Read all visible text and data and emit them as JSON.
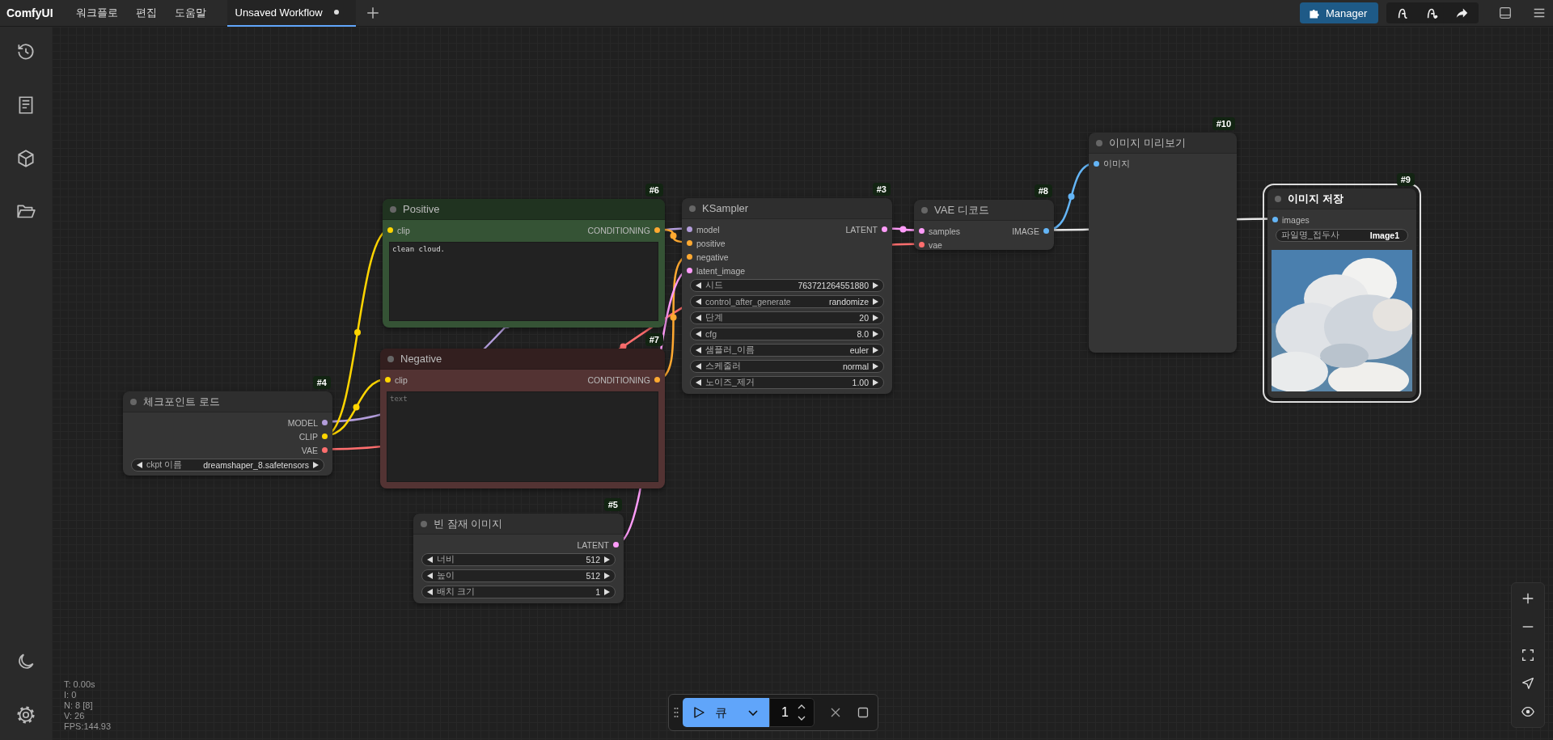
{
  "topbar": {
    "brand": "ComfyUI",
    "menu": [
      {
        "label": "워크플로"
      },
      {
        "label": "편집"
      },
      {
        "label": "도움말"
      }
    ],
    "tabs": [
      {
        "label": "Unsaved Workflow",
        "selected": true,
        "modified": true
      }
    ],
    "manager": "Manager"
  },
  "nodes": [
    {
      "badge": "#4",
      "title": "체크포인트 로드",
      "selected": false,
      "outputs": [
        {
          "name": "MODEL",
          "color": "#b39ddb"
        },
        {
          "name": "CLIP",
          "color": "#ffd500"
        },
        {
          "name": "VAE",
          "color": "#ff6e6e"
        }
      ],
      "widgets": [
        {
          "kind": "combo",
          "label": "ckpt 이름",
          "value": "dreamshaper_8.safetensors"
        }
      ]
    },
    {
      "badge": "#6",
      "title": "Positive",
      "color": "#355335",
      "selected": false,
      "inputs": [
        {
          "name": "clip",
          "color": "#ffd500"
        }
      ],
      "outputs": [
        {
          "name": "CONDITIONING",
          "color": "#ffa931"
        }
      ],
      "textarea": {
        "value": "clean cloud."
      }
    },
    {
      "badge": "#7",
      "title": "Negative",
      "color": "#533333",
      "selected": false,
      "inputs": [
        {
          "name": "clip",
          "color": "#ffd500"
        }
      ],
      "outputs": [
        {
          "name": "CONDITIONING",
          "color": "#ffa931"
        }
      ],
      "textarea": {
        "placeholder": "text"
      }
    },
    {
      "badge": "#5",
      "title": "빈 잠재 이미지",
      "selected": false,
      "outputs": [
        {
          "name": "LATENT",
          "color": "#ff9cf9"
        }
      ],
      "widgets": [
        {
          "kind": "combo",
          "label": "너비",
          "value": "512"
        },
        {
          "kind": "combo",
          "label": "높이",
          "value": "512"
        },
        {
          "kind": "combo",
          "label": "배치 크기",
          "value": "1"
        }
      ]
    },
    {
      "badge": "#3",
      "title": "KSampler",
      "selected": false,
      "inputs": [
        {
          "name": "model",
          "color": "#b39ddb"
        },
        {
          "name": "positive",
          "color": "#ffa931"
        },
        {
          "name": "negative",
          "color": "#ffa931"
        },
        {
          "name": "latent_image",
          "color": "#ff9cf9"
        }
      ],
      "outputs": [
        {
          "name": "LATENT",
          "color": "#ff9cf9"
        }
      ],
      "widgets": [
        {
          "kind": "combo",
          "label": "시드",
          "value": "763721264551880"
        },
        {
          "kind": "combo",
          "label": "control_after_generate",
          "value": "randomize"
        },
        {
          "kind": "combo",
          "label": "단계",
          "value": "20"
        },
        {
          "kind": "combo",
          "label": "cfg",
          "value": "8.0"
        },
        {
          "kind": "combo",
          "label": "샘플러_이름",
          "value": "euler"
        },
        {
          "kind": "combo",
          "label": "스케줄러",
          "value": "normal"
        },
        {
          "kind": "combo",
          "label": "노이즈_제거",
          "value": "1.00"
        }
      ]
    },
    {
      "badge": "#8",
      "title": "VAE 디코드",
      "selected": false,
      "inputs": [
        {
          "name": "samples",
          "color": "#ff9cf9"
        },
        {
          "name": "vae",
          "color": "#ff6e6e"
        }
      ],
      "outputs": [
        {
          "name": "IMAGE",
          "color": "#64b5f6"
        }
      ]
    },
    {
      "badge": "#10",
      "title": "이미지 미리보기",
      "selected": false,
      "inputs": [
        {
          "name": "이미지",
          "color": "#64b5f6"
        }
      ]
    },
    {
      "badge": "#9",
      "title": "이미지 저장",
      "selected": true,
      "inputs": [
        {
          "name": "images",
          "color": "#64b5f6"
        }
      ],
      "widgets": [
        {
          "kind": "text",
          "label": "파일명_접두사",
          "value": "Image1"
        }
      ],
      "preview": {
        "kind": "picture"
      }
    }
  ],
  "stats": [
    "T: 0.00s",
    "I: 0",
    "N: 8 [8]",
    "V: 26",
    "FPS:144.93"
  ],
  "queue": {
    "label": "큐",
    "count": "1"
  }
}
